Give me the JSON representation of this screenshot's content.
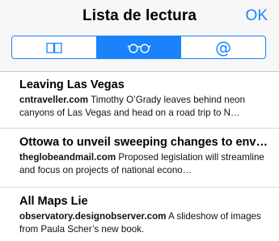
{
  "header": {
    "title": "Lista de lectura",
    "ok_label": "OK",
    "accent_color": "#1a82fb"
  },
  "segments": [
    {
      "icon": "book-icon",
      "selected": false
    },
    {
      "icon": "glasses-icon",
      "selected": true
    },
    {
      "icon": "at-icon",
      "glyph": "@",
      "selected": false
    }
  ],
  "items": [
    {
      "title": "Leaving Las Vegas",
      "source": "cntraveller.com",
      "summary": "Timothy O’Grady leaves behind neon canyons of Las Vegas and head on a road trip to N…"
    },
    {
      "title": "Ottowa to unveil sweeping changes to envi…",
      "source": "theglobeandmail.com",
      "summary": "Proposed legislation will streamline and focus on projects of national econo…"
    },
    {
      "title": "All Maps Lie",
      "source": "observatory.designobserver.com",
      "summary": "A slideshow of images from Paula Scher’s new book."
    }
  ]
}
